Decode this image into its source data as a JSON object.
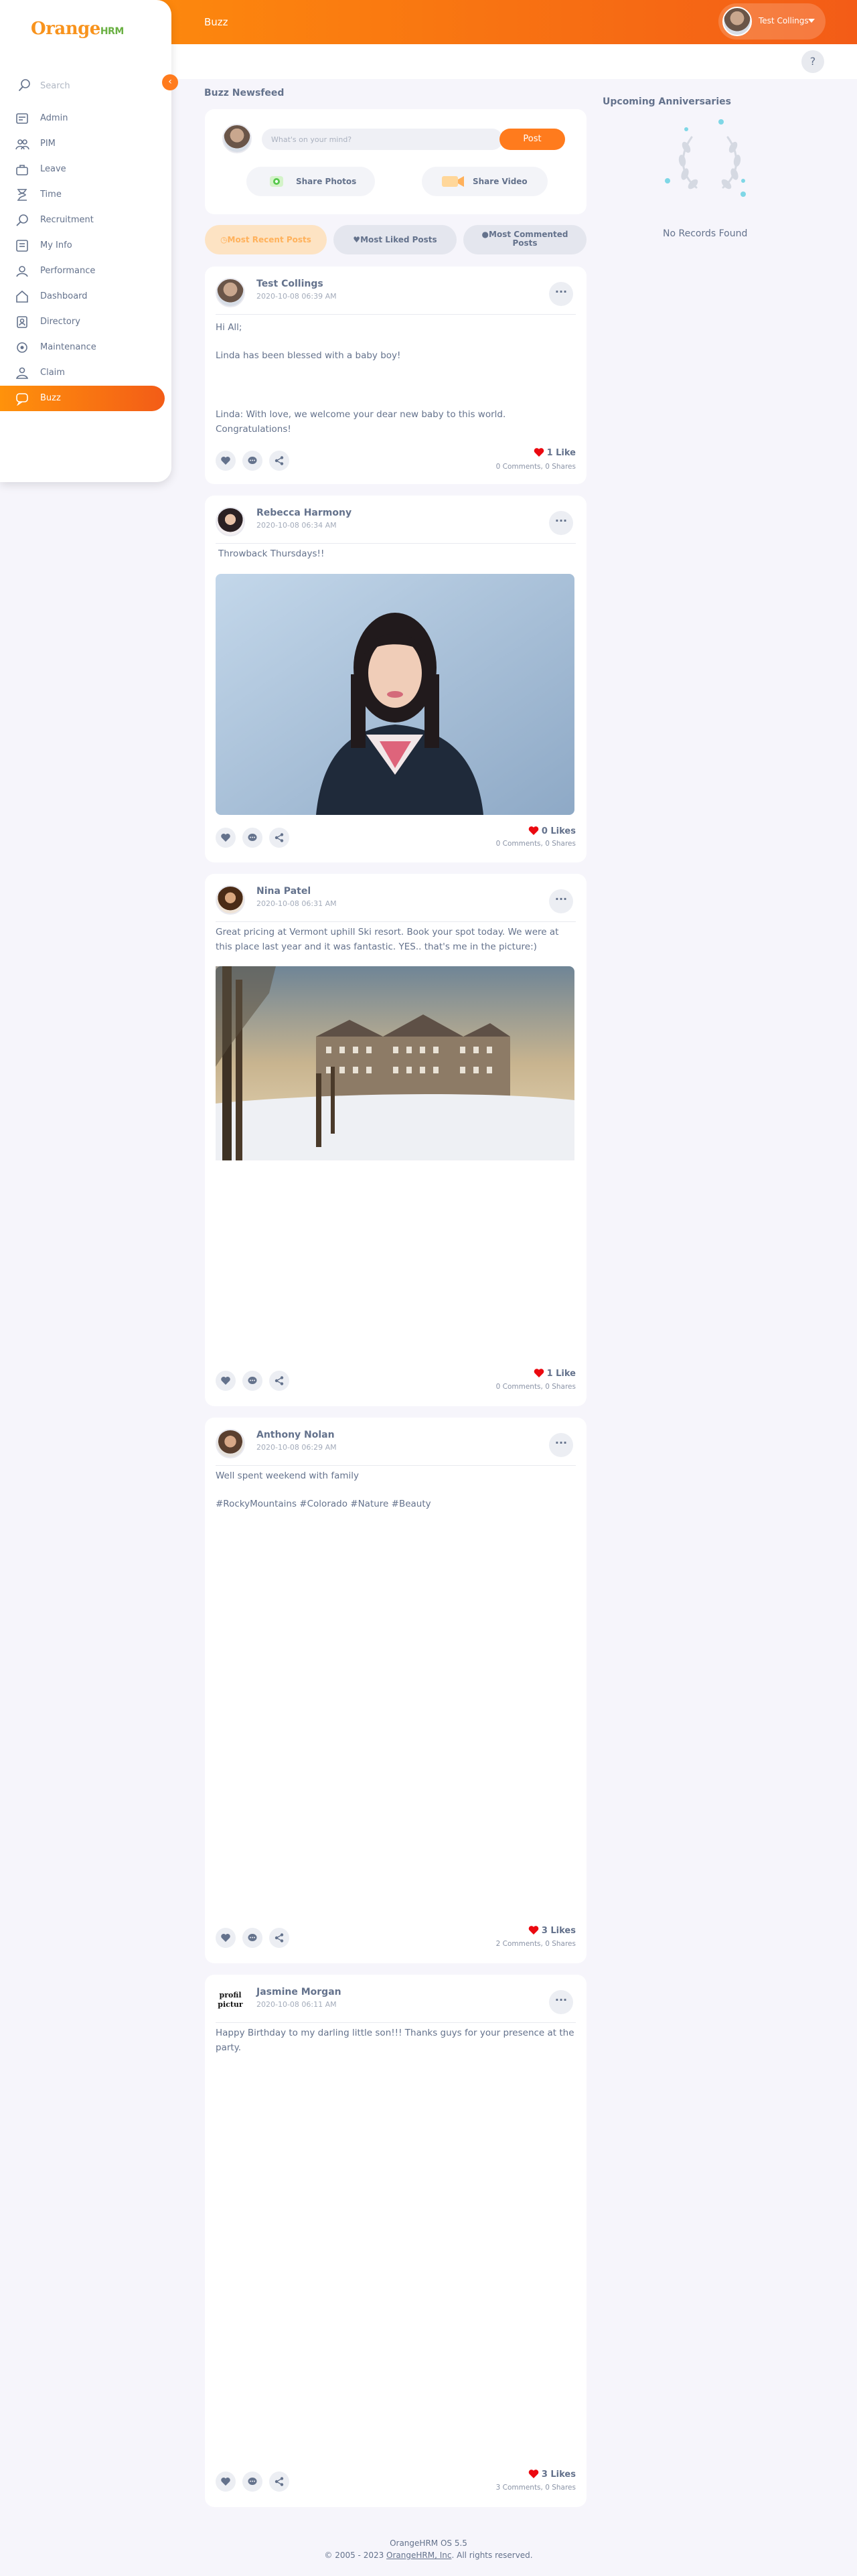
{
  "app": {
    "page_title": "Buzz",
    "brand": {
      "orange": "Orange",
      "hrm": "HRM"
    },
    "colors": {
      "accent": "#ff7b1d",
      "gradient_start": "#ff920b",
      "gradient_end": "#f35c17",
      "text": "#64728c",
      "like_red": "#eb0910"
    }
  },
  "user_menu": {
    "name": "Test Collings"
  },
  "help": {
    "label": "?"
  },
  "sidebar": {
    "search_placeholder": "Search",
    "collapse_icon": "‹",
    "items": [
      {
        "label": "Admin",
        "icon": "admin-icon"
      },
      {
        "label": "PIM",
        "icon": "pim-icon"
      },
      {
        "label": "Leave",
        "icon": "leave-icon"
      },
      {
        "label": "Time",
        "icon": "time-icon"
      },
      {
        "label": "Recruitment",
        "icon": "recruitment-icon"
      },
      {
        "label": "My Info",
        "icon": "my-info-icon"
      },
      {
        "label": "Performance",
        "icon": "performance-icon"
      },
      {
        "label": "Dashboard",
        "icon": "dashboard-icon"
      },
      {
        "label": "Directory",
        "icon": "directory-icon"
      },
      {
        "label": "Maintenance",
        "icon": "maintenance-icon"
      },
      {
        "label": "Claim",
        "icon": "claim-icon"
      },
      {
        "label": "Buzz",
        "icon": "buzz-icon",
        "active": true
      }
    ]
  },
  "newsfeed": {
    "title": "Buzz Newsfeed",
    "composer": {
      "placeholder": "What's on your mind?",
      "post_label": "Post",
      "share_photos_label": "Share Photos",
      "share_video_label": "Share Video"
    },
    "filters": {
      "recent": "Most Recent Posts",
      "liked": "Most Liked Posts",
      "commented_line1": "Most Commented",
      "commented_line2": "Posts"
    },
    "posts": [
      {
        "author": "Test Collings",
        "date": "2020-10-08 06:39 AM",
        "lines": [
          "Hi All;",
          "Linda has been blessed with a baby boy!",
          "Linda: With love, we welcome your dear new baby to this world. Congratulations!"
        ],
        "likes": "1 Like",
        "stats": "0 Comments, 0 Shares"
      },
      {
        "author": "Rebecca Harmony",
        "date": "2020-10-08 06:34 AM",
        "lines": [
          "Throwback Thursdays!!"
        ],
        "likes": "0 Likes",
        "stats": "0 Comments, 0 Shares"
      },
      {
        "author": "Nina Patel",
        "date": "2020-10-08 06:31 AM",
        "lines": [
          "Great pricing at Vermont uphill Ski resort. Book your spot today. We were at this place last year and it was fantastic. YES.. that's me in the picture:)"
        ],
        "likes": "1 Like",
        "stats": "0 Comments, 0 Shares"
      },
      {
        "author": "Anthony Nolan",
        "date": "2020-10-08 06:29 AM",
        "lines": [
          "Well spent weekend with family",
          "#RockyMountains #Colorado #Nature #Beauty"
        ],
        "likes": "3 Likes",
        "stats": "2 Comments, 0 Shares"
      },
      {
        "author": "Jasmine Morgan",
        "avatar_text_1": "profil",
        "avatar_text_2": "pictur",
        "date": "2020-10-08 06:11 AM",
        "lines": [
          "Happy Birthday to my darling little son!!! Thanks guys for your presence at the party."
        ],
        "likes": "3 Likes",
        "stats": "3 Comments, 0 Shares"
      }
    ]
  },
  "anniversaries": {
    "title": "Upcoming Anniversaries",
    "empty": "No Records Found"
  },
  "footer": {
    "version": "OrangeHRM OS 5.5",
    "copyright_prefix": "© 2005 - 2023 ",
    "company_link": "OrangeHRM, Inc",
    "copyright_suffix": ". All rights reserved."
  }
}
